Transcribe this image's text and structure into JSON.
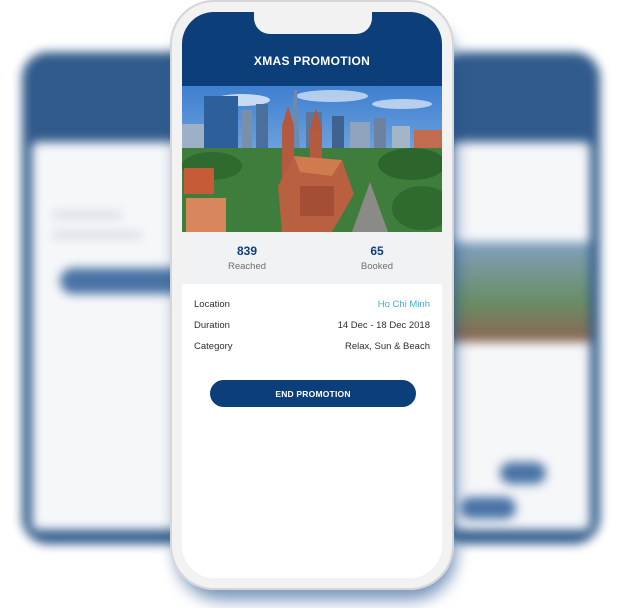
{
  "promotion": {
    "title": "XMAS PROMOTION",
    "stats": [
      {
        "value": "839",
        "label": "Reached"
      },
      {
        "value": "65",
        "label": "Booked"
      }
    ],
    "details": [
      {
        "key": "Location",
        "value": "Ho Chi Minh"
      },
      {
        "key": "Duration",
        "value": "14 Dec - 18 Dec 2018"
      },
      {
        "key": "Category",
        "value": "Relax, Sun & Beach"
      }
    ],
    "cta_label": "END PROMOTION"
  },
  "colors": {
    "primary": "#0c3f7a",
    "link": "#3fb2d8",
    "stats_background": "#f1f2f4"
  }
}
